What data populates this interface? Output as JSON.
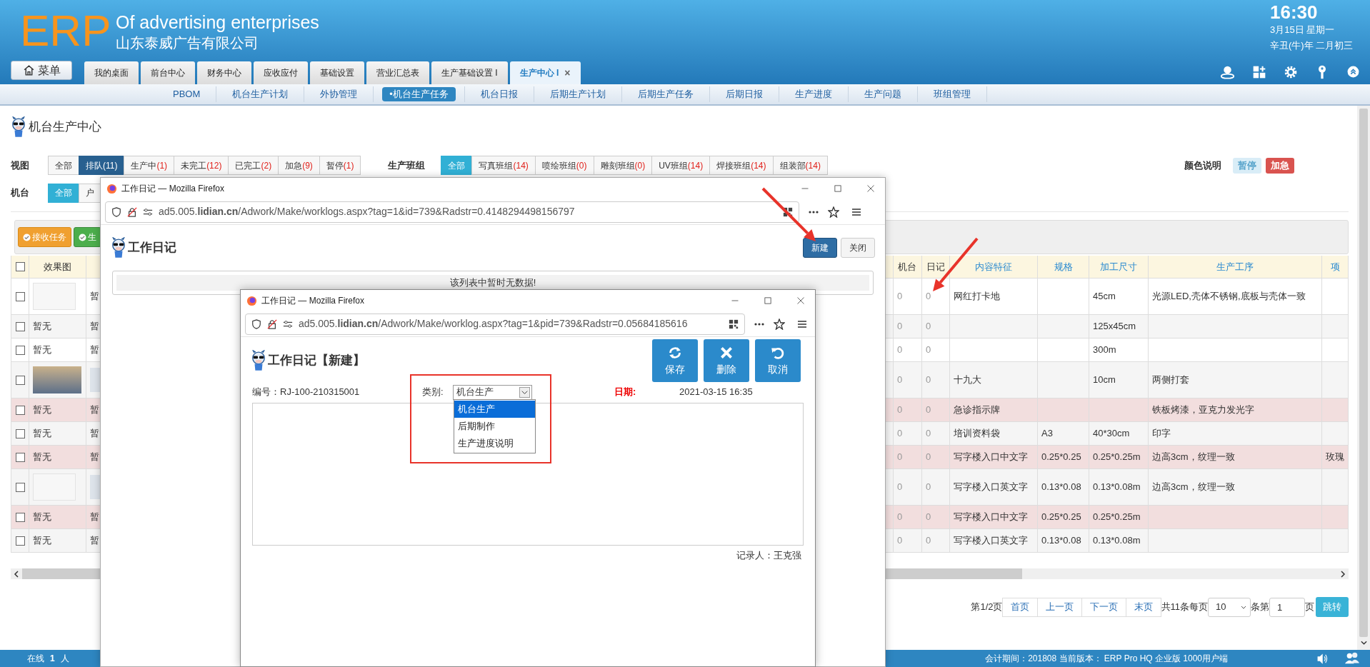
{
  "header": {
    "logo": "ERP",
    "title": "Of advertising enterprises",
    "company": "山东泰威广告有限公司",
    "time": "16:30",
    "date": "3月15日 星期一",
    "lunar": "辛丑(牛)年 二月初三"
  },
  "menu_button": "菜单",
  "tabs": [
    {
      "label": "我的桌面",
      "selected": false
    },
    {
      "label": "前台中心",
      "selected": false
    },
    {
      "label": "财务中心",
      "selected": false
    },
    {
      "label": "应收应付",
      "selected": false
    },
    {
      "label": "基础设置",
      "selected": false
    },
    {
      "label": "营业汇总表",
      "selected": false
    },
    {
      "label": "生产基础设置 I",
      "selected": false
    },
    {
      "label": "生产中心 I",
      "selected": true,
      "close": "×"
    }
  ],
  "subnav": [
    {
      "label": "PBOM",
      "selected": false
    },
    {
      "label": "机台生产计划",
      "selected": false
    },
    {
      "label": "外协管理",
      "selected": false
    },
    {
      "label": "•机台生产任务",
      "selected": true
    },
    {
      "label": "机台日报",
      "selected": false
    },
    {
      "label": "后期生产计划",
      "selected": false
    },
    {
      "label": "后期生产任务",
      "selected": false
    },
    {
      "label": "后期日报",
      "selected": false
    },
    {
      "label": "生产进度",
      "selected": false
    },
    {
      "label": "生产问题",
      "selected": false
    },
    {
      "label": "班组管理",
      "selected": false
    }
  ],
  "page_title": "机台生产中心",
  "view": {
    "label": "视图",
    "filters": [
      {
        "label": "全部",
        "selected": false
      },
      {
        "label": "排队",
        "count": "(11)",
        "selected": true
      },
      {
        "label": "生产中",
        "count": "(1)",
        "selected": false
      },
      {
        "label": "未完工",
        "count": "(12)",
        "selected": false
      },
      {
        "label": "已完工",
        "count": "(2)",
        "selected": false
      },
      {
        "label": "加急",
        "count": "(9)",
        "selected": false
      },
      {
        "label": "暂停",
        "count": "(1)",
        "selected": false
      }
    ]
  },
  "teams": {
    "label": "生产班组",
    "filters": [
      {
        "label": "全部",
        "selected": true
      },
      {
        "label": "写真班组",
        "count": "(14)",
        "selected": false
      },
      {
        "label": "喷绘班组",
        "count": "(0)",
        "selected": false
      },
      {
        "label": "雕刻班组",
        "count": "(0)",
        "selected": false
      },
      {
        "label": "UV班组",
        "count": "(14)",
        "selected": false
      },
      {
        "label": "焊接班组",
        "count": "(14)",
        "selected": false
      },
      {
        "label": "组装部",
        "count": "(14)",
        "selected": false
      }
    ]
  },
  "legend": {
    "label": "颜色说明",
    "items": [
      {
        "label": "暂停",
        "color": "#d9edf7"
      },
      {
        "label": "加急",
        "color": "#d9534f"
      }
    ]
  },
  "machine": {
    "label": "机台",
    "filters": [
      {
        "label": "全部",
        "selected": true
      },
      {
        "label": "户",
        "selected": false
      }
    ]
  },
  "toolbar": [
    {
      "label": "接收任务",
      "kind": "receive"
    },
    {
      "label": "生",
      "kind": "confirm"
    }
  ],
  "table": {
    "columns_left": [
      "效果图"
    ],
    "columns_right": [
      "机台",
      "日记",
      "内容特征",
      "规格",
      "加工尺寸",
      "生产工序",
      "项"
    ],
    "select_all_checked": false,
    "rows": [
      {
        "kind": "graphic",
        "checked": false,
        "column_3": "暂",
        "machine": "0",
        "log": "0",
        "content": "网红打卡地",
        "size": "45cm",
        "process": "光源LED,壳体不锈钢,底板与壳体一致",
        "urgent": false
      },
      {
        "kind": "text",
        "checked": false,
        "effect": "暂无",
        "column_3": "暂",
        "machine": "0",
        "log": "0",
        "size": "125x45cm",
        "urgent": false
      },
      {
        "kind": "text",
        "checked": false,
        "effect": "暂无",
        "column_3": "暂",
        "machine": "0",
        "log": "0",
        "size": "300m",
        "urgent": false
      },
      {
        "kind": "photo",
        "checked": false,
        "column_3_thumbnail": true,
        "machine": "0",
        "log": "0",
        "content": "十九大",
        "size": "10cm",
        "process": "两侧打套",
        "urgent": false
      },
      {
        "kind": "text",
        "checked": false,
        "effect": "暂无",
        "column_3": "暂",
        "machine": "0",
        "log": "0",
        "content": "急诊指示牌",
        "process": "铁板烤漆，亚克力发光字",
        "urgent": true
      },
      {
        "kind": "text",
        "checked": false,
        "effect": "暂无",
        "column_3": "暂",
        "machine": "0",
        "log": "0",
        "content": "培训资料袋",
        "spec": "A3",
        "size": "40*30cm",
        "process": "印字",
        "urgent": false
      },
      {
        "kind": "text",
        "checked": false,
        "effect": "暂无",
        "column_3": "暂",
        "machine": "0",
        "log": "0",
        "content": "写字楼入口中文字",
        "spec": "0.25*0.25",
        "size": "0.25*0.25m",
        "process": "边高3cm，纹理一致",
        "project": "玫瑰",
        "urgent": true
      },
      {
        "kind": "graphic",
        "checked": false,
        "column_3_thumbnail": true,
        "machine": "0",
        "log": "0",
        "content": "写字楼入口英文字",
        "spec": "0.13*0.08",
        "size": "0.13*0.08m",
        "process": "边高3cm，纹理一致",
        "urgent": false
      },
      {
        "kind": "text",
        "checked": false,
        "effect": "暂无",
        "column_3": "暂",
        "machine": "0",
        "log": "0",
        "content": "写字楼入口中文字",
        "spec": "0.25*0.25",
        "size": "0.25*0.25m",
        "urgent": true
      },
      {
        "kind": "text",
        "checked": false,
        "effect": "暂无",
        "column_3": "暂",
        "machine": "0",
        "log": "0",
        "content": "写字楼入口英文字",
        "spec": "0.13*0.08",
        "size": "0.13*0.08m",
        "urgent": false
      }
    ]
  },
  "pagination": {
    "page_info": "第1/2页",
    "buttons": [
      "首页",
      "上一页",
      "下一页",
      "末页"
    ],
    "total": "共11条每页",
    "per_page": "10",
    "between": "条第",
    "page": "1",
    "page_suffix": "页",
    "go": "跳转"
  },
  "status_bar": {
    "online_label": "在线",
    "online_count": "1",
    "online_unit": "人",
    "info": "会计期间：201808 当前版本： ERP Pro HQ 企业版 1000用户端"
  },
  "popup_list": {
    "window_title": "工作日记 — Mozilla Firefox",
    "url": "ad5.005.**lidian.cn**/Adwork/Make/worklogs.aspx?tag=1&id=739&Radstr=0.4148294498156797",
    "heading": "工作日记",
    "buttons": [
      {
        "label": "新建",
        "kind": "primary"
      },
      {
        "label": "关闭",
        "kind": "default"
      }
    ],
    "empty_message": "该列表中暂时无数据!"
  },
  "popup_new": {
    "window_title": "工作日记 — Mozilla Firefox",
    "url": "ad5.005.**lidian.cn**/Adwork/Make/worklog.aspx?tag=1&pid=739&Radstr=0.05684185616",
    "heading": "工作日记【新建】",
    "actions": [
      {
        "label": "保存",
        "kind": "save"
      },
      {
        "label": "删除",
        "kind": "delete"
      },
      {
        "label": "取消",
        "kind": "cancel"
      }
    ],
    "number_label": "编号：",
    "number": "RJ-100-210315001",
    "category_label": "类别:",
    "category": "机台生产",
    "expanded": true,
    "options": [
      {
        "label": "机台生产",
        "selected": true
      },
      {
        "label": "后期制作",
        "selected": false
      },
      {
        "label": "生产进度说明",
        "selected": false
      }
    ],
    "date_label": "日期:",
    "date": "2021-03-15 16:35",
    "recorder": "记录人：王克强"
  }
}
